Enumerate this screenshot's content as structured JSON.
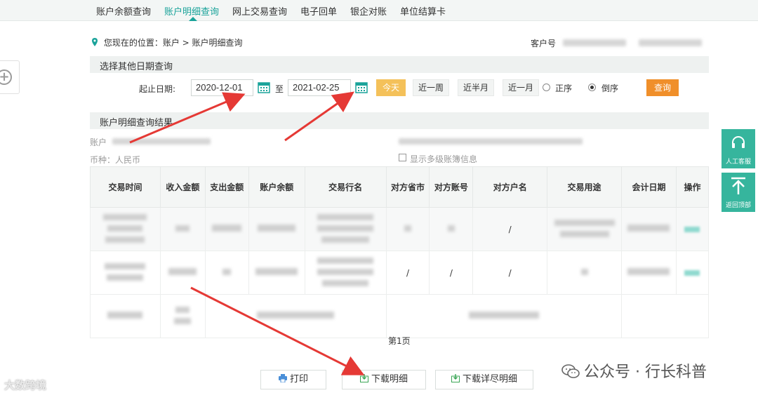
{
  "nav": {
    "tabs": [
      {
        "label": "账户余额查询"
      },
      {
        "label": "账户明细查询"
      },
      {
        "label": "网上交易查询"
      },
      {
        "label": "电子回单"
      },
      {
        "label": "银企对账"
      },
      {
        "label": "单位结算卡"
      }
    ],
    "active_index": 1
  },
  "location": {
    "text": "您现在的位置：账户 > 账户明细查询"
  },
  "customer": {
    "label": "客户号"
  },
  "query": {
    "section_title": "选择其他日期查询",
    "date_label": "起止日期:",
    "start_date": "2020-12-01",
    "to_label": "至",
    "end_date": "2021-02-25",
    "today_label": "今天",
    "ranges": [
      "近一周",
      "近半月",
      "近一月"
    ],
    "order_asc": "正序",
    "order_desc": "倒序",
    "selected_order": "倒序",
    "submit_label": "查询"
  },
  "result": {
    "section_title": "账户明细查询结果",
    "account_label": "账户",
    "currency": "币种：人民币",
    "show_multilevel_label": "显示多级账簿信息",
    "columns": [
      "交易时间",
      "收入金额",
      "支出金额",
      "账户余额",
      "交易行名",
      "对方省市",
      "对方账号",
      "对方户名",
      "交易用途",
      "会计日期",
      "操作"
    ],
    "slash": "/",
    "page_label": "第1页"
  },
  "actions": {
    "print_label": "打印",
    "download_label": "下载明细",
    "download_detail_label": "下载详尽明细"
  },
  "side": {
    "service_label": "人工客服",
    "top_label": "返回顶部"
  },
  "watermarks": {
    "left": "大数跨境",
    "right": "公众号 · 行长科普"
  },
  "colors": {
    "accent": "#1aa39a",
    "today": "#f4c15a",
    "query": "#f08f2a",
    "float": "#36b59d",
    "arrow": "#e53935"
  }
}
